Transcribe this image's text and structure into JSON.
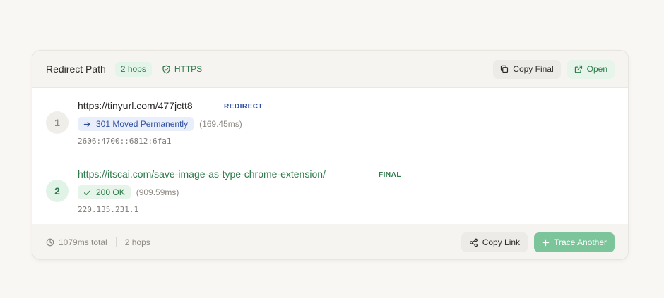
{
  "header": {
    "title": "Redirect Path",
    "hops_badge": "2 hops",
    "https_label": "HTTPS",
    "copy_final_label": "Copy Final",
    "open_label": "Open"
  },
  "hops": [
    {
      "number": "1",
      "url": "https://tinyurl.com/477jctt8",
      "tag": "REDIRECT",
      "status": "301 Moved Permanently",
      "timing": "(169.45ms)",
      "ip": "2606:4700::6812:6fa1"
    },
    {
      "number": "2",
      "url": "https://itscai.com/save-image-as-type-chrome-extension/",
      "tag": "FINAL",
      "status": "200 OK",
      "timing": "(909.59ms)",
      "ip": "220.135.231.1"
    }
  ],
  "footer": {
    "total_time": "1079ms total",
    "hops_count": "2 hops",
    "copy_link_label": "Copy Link",
    "trace_another_label": "Trace Another"
  },
  "colors": {
    "accent_green": "#2f7a4a",
    "accent_blue": "#2f4fa0",
    "trace_button": "#7cc59a"
  },
  "icons": {
    "https": "shield-icon",
    "copy_final": "copy-icon",
    "open": "external-link-icon",
    "redirect_status": "arrow-right-icon",
    "final_status": "check-icon",
    "total_time": "clock-icon",
    "copy_link": "share-icon",
    "trace_another": "plus-icon"
  }
}
